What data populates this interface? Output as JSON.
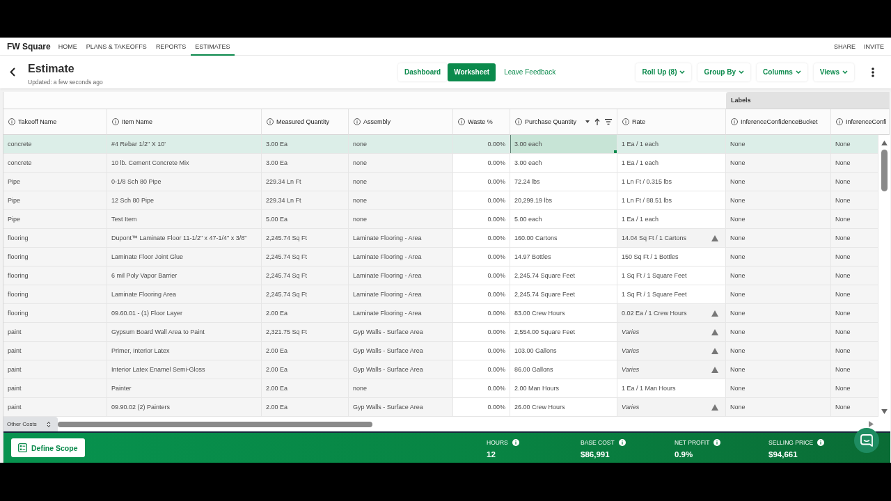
{
  "top_nav": {
    "brand": "FW Square",
    "items": [
      {
        "label": "HOME",
        "selected": false
      },
      {
        "label": "PLANS & TAKEOFFS",
        "selected": false
      },
      {
        "label": "REPORTS",
        "selected": false
      },
      {
        "label": "ESTIMATES",
        "selected": true
      }
    ],
    "actions": [
      "SHARE",
      "INVITE"
    ]
  },
  "header": {
    "title": "Estimate",
    "subtitle": "Updated: a few seconds ago",
    "view_tabs": [
      {
        "label": "Dashboard",
        "selected": false
      },
      {
        "label": "Worksheet",
        "selected": true
      }
    ],
    "feedback_link": "Leave Feedback",
    "toolbar_buttons": [
      "Roll Up (8)",
      "Group By",
      "Columns",
      "Views"
    ]
  },
  "table": {
    "columns": [
      {
        "label": "Takeoff Name",
        "sorted": false,
        "hovered": false
      },
      {
        "label": "Item Name",
        "sorted": false,
        "hovered": false
      },
      {
        "label": "Measured Quantity",
        "sorted": false,
        "hovered": false
      },
      {
        "label": "Assembly",
        "sorted": false,
        "hovered": false
      },
      {
        "label": "Waste %",
        "sorted": false,
        "hovered": false
      },
      {
        "label": "Purchase Quantity",
        "sorted": true,
        "hovered": true
      },
      {
        "label": "Rate",
        "sorted": false,
        "hovered": false
      }
    ],
    "column_group": {
      "label": "Labels",
      "columns": [
        {
          "label": "InferenceConfidenceBucket"
        },
        {
          "label": "InferenceConfi"
        }
      ]
    },
    "rows": [
      {
        "selected": true,
        "takeoff_name": "concrete",
        "item_name": "#4 Rebar 1/2\" X 10'",
        "measured_quantity": "3.00 Ea",
        "assembly": "none",
        "waste": "0.00%",
        "purchase_quantity": {
          "text": "3.00 each",
          "focused": true
        },
        "rate": {
          "text": "1 Ea / 1 each",
          "kind": "ratio",
          "warning": false
        },
        "inference_confidence_bucket": "None",
        "column_9": "None"
      },
      {
        "selected": false,
        "takeoff_name": "concrete",
        "item_name": "10 lb. Cement Concrete Mix",
        "measured_quantity": "3.00 Ea",
        "assembly": "none",
        "waste": "0.00%",
        "purchase_quantity": {
          "text": "3.00 each",
          "focused": false
        },
        "rate": {
          "text": "1 Ea / 1 each",
          "kind": "ratio",
          "warning": false
        },
        "inference_confidence_bucket": "None",
        "column_9": "None"
      },
      {
        "selected": false,
        "takeoff_name": "Pipe",
        "item_name": "0-1/8 Sch 80 Pipe",
        "measured_quantity": "229.34 Ln Ft",
        "assembly": "none",
        "waste": "0.00%",
        "purchase_quantity": {
          "text": "72.24 lbs",
          "focused": false
        },
        "rate": {
          "text": "1 Ln Ft / 0.315 lbs",
          "kind": "ratio",
          "warning": false
        },
        "inference_confidence_bucket": "None",
        "column_9": "None"
      },
      {
        "selected": false,
        "takeoff_name": "Pipe",
        "item_name": "12 Sch 80 Pipe",
        "measured_quantity": "229.34 Ln Ft",
        "assembly": "none",
        "waste": "0.00%",
        "purchase_quantity": {
          "text": "20,299.19 lbs",
          "focused": false
        },
        "rate": {
          "text": "1 Ln Ft / 88.51 lbs",
          "kind": "ratio",
          "warning": false
        },
        "inference_confidence_bucket": "None",
        "column_9": "None"
      },
      {
        "selected": false,
        "takeoff_name": "Pipe",
        "item_name": "Test Item",
        "measured_quantity": "5.00 Ea",
        "assembly": "none",
        "waste": "0.00%",
        "purchase_quantity": {
          "text": "5.00 each",
          "focused": false
        },
        "rate": {
          "text": "1 Ea / 1 each",
          "kind": "ratio",
          "warning": false
        },
        "inference_confidence_bucket": "None",
        "column_9": "None"
      },
      {
        "selected": false,
        "takeoff_name": "flooring",
        "item_name": "Dupont™ Laminate Floor 11-1/2\" x 47-1/4\" x 3/8\"",
        "measured_quantity": "2,245.74 Sq Ft",
        "assembly": "Laminate Flooring - Area",
        "waste": "0.00%",
        "purchase_quantity": {
          "text": "160.00 Cartons",
          "focused": false
        },
        "rate": {
          "text": "14.04 Sq Ft / 1 Cartons",
          "kind": "ratio",
          "warning": true
        },
        "inference_confidence_bucket": "None",
        "column_9": "None"
      },
      {
        "selected": false,
        "takeoff_name": "flooring",
        "item_name": "Laminate Floor Joint Glue",
        "measured_quantity": "2,245.74 Sq Ft",
        "assembly": "Laminate Flooring - Area",
        "waste": "0.00%",
        "purchase_quantity": {
          "text": "14.97 Bottles",
          "focused": false
        },
        "rate": {
          "text": "150 Sq Ft / 1 Bottles",
          "kind": "ratio",
          "warning": false
        },
        "inference_confidence_bucket": "None",
        "column_9": "None"
      },
      {
        "selected": false,
        "takeoff_name": "flooring",
        "item_name": "6 mil Poly Vapor Barrier",
        "measured_quantity": "2,245.74 Sq Ft",
        "assembly": "Laminate Flooring - Area",
        "waste": "0.00%",
        "purchase_quantity": {
          "text": "2,245.74 Square Feet",
          "focused": false
        },
        "rate": {
          "text": "1 Sq Ft / 1 Square Feet",
          "kind": "ratio",
          "warning": false
        },
        "inference_confidence_bucket": "None",
        "column_9": "None"
      },
      {
        "selected": false,
        "takeoff_name": "flooring",
        "item_name": "Laminate Flooring Area",
        "measured_quantity": "2,245.74 Sq Ft",
        "assembly": "Laminate Flooring - Area",
        "waste": "0.00%",
        "purchase_quantity": {
          "text": "2,245.74 Square Feet",
          "focused": false
        },
        "rate": {
          "text": "1 Sq Ft / 1 Square Feet",
          "kind": "ratio",
          "warning": false
        },
        "inference_confidence_bucket": "None",
        "column_9": "None"
      },
      {
        "selected": false,
        "takeoff_name": "flooring",
        "item_name": "09.60.01 - (1) Floor Layer",
        "measured_quantity": "2.00 Ea",
        "assembly": "Laminate Flooring - Area",
        "waste": "0.00%",
        "purchase_quantity": {
          "text": "83.00 Crew Hours",
          "focused": false
        },
        "rate": {
          "text": "0.02 Ea / 1 Crew Hours",
          "kind": "ratio",
          "warning": true
        },
        "inference_confidence_bucket": "None",
        "column_9": "None"
      },
      {
        "selected": false,
        "takeoff_name": "paint",
        "item_name": "Gypsum Board Wall Area to Paint",
        "measured_quantity": "2,321.75 Sq Ft",
        "assembly": "Gyp Walls - Surface Area",
        "waste": "0.00%",
        "purchase_quantity": {
          "text": "2,554.00 Square Feet",
          "focused": false
        },
        "rate": {
          "text": "Varies",
          "kind": "varies",
          "warning": true
        },
        "inference_confidence_bucket": "None",
        "column_9": "None"
      },
      {
        "selected": false,
        "takeoff_name": "paint",
        "item_name": "Primer, Interior Latex",
        "measured_quantity": "2.00 Ea",
        "assembly": "Gyp Walls - Surface Area",
        "waste": "0.00%",
        "purchase_quantity": {
          "text": "103.00 Gallons",
          "focused": false
        },
        "rate": {
          "text": "Varies",
          "kind": "varies",
          "warning": true
        },
        "inference_confidence_bucket": "None",
        "column_9": "None"
      },
      {
        "selected": false,
        "takeoff_name": "paint",
        "item_name": "Interior Latex Enamel Semi-Gloss",
        "measured_quantity": "2.00 Ea",
        "assembly": "Gyp Walls - Surface Area",
        "waste": "0.00%",
        "purchase_quantity": {
          "text": "86.00 Gallons",
          "focused": false
        },
        "rate": {
          "text": "Varies",
          "kind": "varies",
          "warning": true
        },
        "inference_confidence_bucket": "None",
        "column_9": "None"
      },
      {
        "selected": false,
        "takeoff_name": "paint",
        "item_name": "Painter",
        "measured_quantity": "2.00 Ea",
        "assembly": "none",
        "waste": "0.00%",
        "purchase_quantity": {
          "text": "2.00 Man Hours",
          "focused": false
        },
        "rate": {
          "text": "1 Ea / 1 Man Hours",
          "kind": "ratio",
          "warning": false
        },
        "inference_confidence_bucket": "None",
        "column_9": "None"
      },
      {
        "selected": false,
        "takeoff_name": "paint",
        "item_name": "09.90.02 (2) Painters",
        "measured_quantity": "2.00 Ea",
        "assembly": "Gyp Walls - Surface Area",
        "waste": "0.00%",
        "purchase_quantity": {
          "text": "26.00 Crew Hours",
          "focused": false
        },
        "rate": {
          "text": "Varies",
          "kind": "varies",
          "warning": true
        },
        "inference_confidence_bucket": "None",
        "column_9": "None"
      }
    ]
  },
  "cost_selector": "Other Costs",
  "footer": {
    "define_scope_button": "Define Scope",
    "stats": [
      {
        "label": "HOURS",
        "value": "12"
      },
      {
        "label": "BASE COST",
        "value": "$86,991"
      },
      {
        "label": "NET PROFIT",
        "value": "0.9%"
      },
      {
        "label": "SELLING PRICE",
        "value": "$94,661"
      }
    ]
  }
}
